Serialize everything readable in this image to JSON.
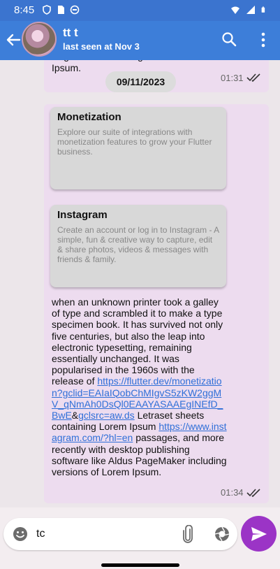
{
  "status_bar": {
    "time": "8:45"
  },
  "header": {
    "title": "tt t",
    "subtitle": "last seen at Nov 3"
  },
  "previous_message": {
    "text": "PageMaker including versions of Lorem Ipsum.",
    "time": "01:31"
  },
  "date_divider": "09/11/2023",
  "message": {
    "cards": [
      {
        "title": "Monetization",
        "description": "Explore our suite of integrations with monetization features to grow your Flutter business."
      },
      {
        "title": "Instagram",
        "description": "Create an account or log in to Instagram - A simple, fun & creative way to capture, edit & share photos, videos & messages with friends & family."
      }
    ],
    "text_part1": "when an unknown printer took a galley of type and scrambled it to make a type specimen book. It has survived not only five centuries, but also the leap into electronic typesetting, remaining essentially unchanged. It was popularised in the 1960s with the release of ",
    "link1_a": "https://flutter.dev/monetization?gclid=EAIaIQobChMIgvS5zKW2ggMV_qNmAh0DsQl0EAAYASAAEgINEfD_BwE",
    "amp": "&",
    "link1_b": "gclsrc=aw.ds",
    "text_part2": " Letraset sheets containing Lorem Ipsum ",
    "link2": "https://www.instagram.com/?hl=en",
    "text_part3": " passages, and more recently with desktop publishing software like Aldus PageMaker including versions of Lorem Ipsum.",
    "time": "01:34"
  },
  "composer": {
    "value": "tc"
  },
  "colors": {
    "appbar": "#3d7ed9",
    "bubble": "#eddcef",
    "send_button": "#9b34c6",
    "link": "#2f6fd8"
  },
  "icons": [
    "back-arrow-icon",
    "search-icon",
    "more-vert-icon",
    "double-check-icon",
    "emoji-icon",
    "attach-icon",
    "camera-icon",
    "send-icon"
  ]
}
